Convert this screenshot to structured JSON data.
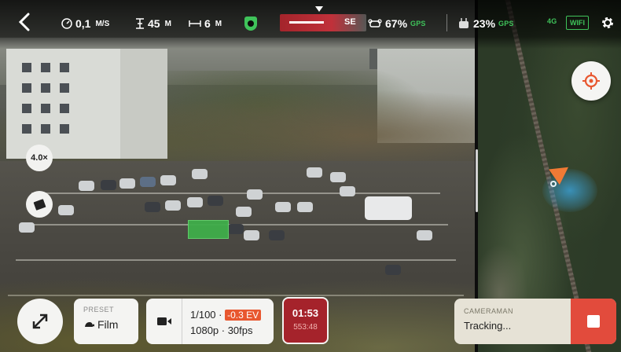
{
  "status_bar": {
    "back_icon": "chevron-left-icon",
    "speed_value": "0,1",
    "speed_unit": "M/S",
    "altitude_value": "45",
    "altitude_unit": "M",
    "distance_value": "6",
    "distance_unit": "M",
    "shield_color": "#3fc35a",
    "compass_heading": "SE",
    "drone_battery": "67%",
    "drone_gps_label": "GPS",
    "controller_battery": "23%",
    "controller_gps_label": "GPS",
    "network_label": "4G",
    "wifi_label": "WIFI",
    "settings_icon": "gear-icon"
  },
  "feed": {
    "zoom_level": "4.0×",
    "tracking_box_color": "#3fae4a"
  },
  "map": {
    "drone_marker_color": "#f07a35",
    "recenter_icon": "crosshair-icon"
  },
  "bottom": {
    "preset_label": "PRESET",
    "preset_value": "Film",
    "shutter": "1/100",
    "ev": "-0.3 EV",
    "resolution": "1080p · 30fps",
    "record_time": "01:53",
    "remaining_time": "553:48",
    "cameraman_label": "CAMERAMAN",
    "cameraman_status": "Tracking..."
  },
  "colors": {
    "accent_red": "#a5232b",
    "stop_red": "#e24b3c",
    "ev_orange": "#e8572f",
    "ok_green": "#3fc35a"
  }
}
